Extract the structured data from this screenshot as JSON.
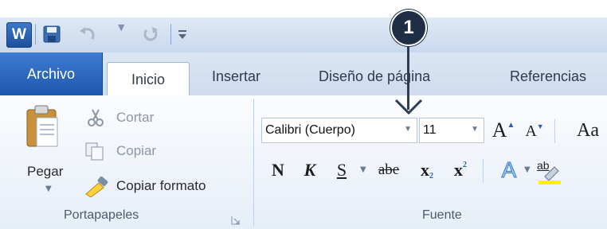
{
  "quick_access": {
    "app_logo": "W",
    "icons": [
      "word-app-icon",
      "save-icon",
      "undo-icon",
      "redo-icon",
      "customize-toolbar-icon"
    ]
  },
  "tabs": {
    "file": "Archivo",
    "items": [
      "Inicio",
      "Insertar",
      "Diseño de página",
      "Referencias"
    ],
    "active": "Inicio"
  },
  "clipboard_group": {
    "paste": "Pegar",
    "cut": "Cortar",
    "copy": "Copiar",
    "format_painter": "Copiar formato",
    "label": "Portapapeles"
  },
  "font_group": {
    "font_name": "Calibri (Cuerpo)",
    "font_size": "11",
    "grow_font": "A",
    "shrink_font": "A",
    "change_case": "Aa",
    "bold": "N",
    "italic": "K",
    "underline": "S",
    "strikethrough": "abe",
    "subscript": "x",
    "superscript": "x",
    "text_effects": "A",
    "highlight": "ab",
    "label": "Fuente"
  },
  "annotation": {
    "number": "1"
  },
  "colors": {
    "file_tab": "#2a64be",
    "ribbon_bg": "#e6eef8",
    "badge": "#1e2f45"
  }
}
